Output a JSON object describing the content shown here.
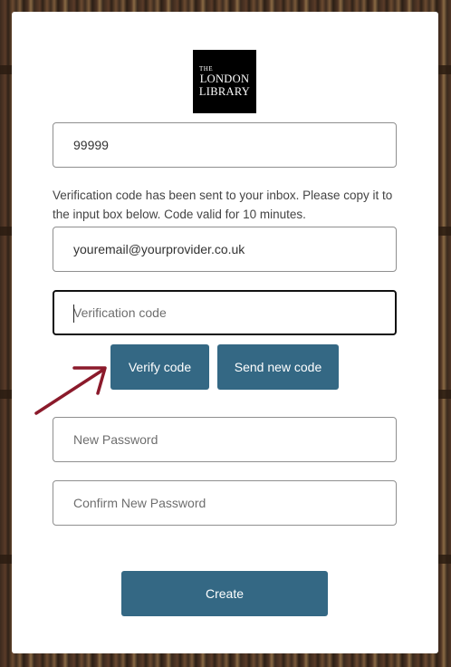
{
  "logo": {
    "line1": "THE",
    "line2": "LONDON",
    "line3": "LIBRARY"
  },
  "form": {
    "username_value": "99999",
    "verification_message": "Verification code has been sent to your inbox. Please copy it to the input box below. Code valid for 10 minutes.",
    "email_value": "youremail@yourprovider.co.uk",
    "code_placeholder": "Verification code",
    "verify_button_label": "Verify code",
    "send_new_code_label": "Send new code",
    "new_password_placeholder": "New Password",
    "confirm_password_placeholder": "Confirm New Password",
    "create_button_label": "Create"
  },
  "colors": {
    "button": "#346884",
    "annotation_arrow": "#8b1a2b"
  }
}
